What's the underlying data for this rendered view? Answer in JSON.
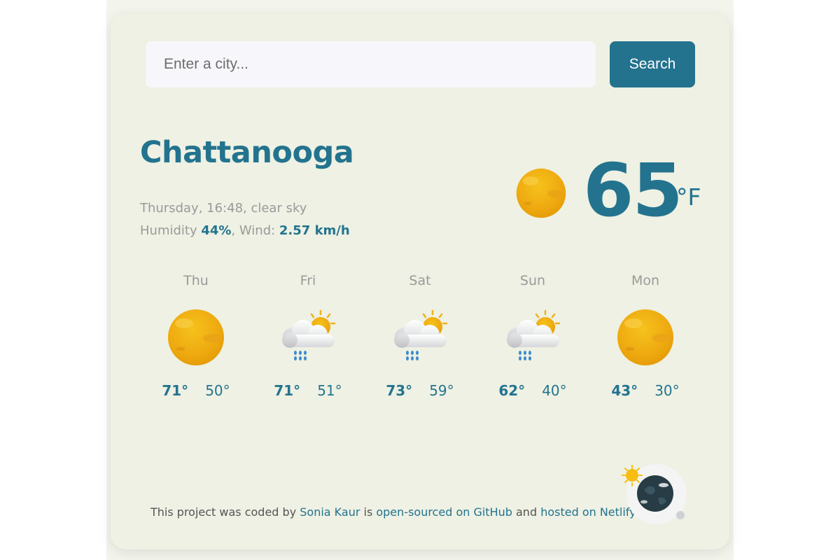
{
  "search": {
    "placeholder": "Enter a city...",
    "value": "",
    "button_label": "Search"
  },
  "current": {
    "city": "Chattanooga",
    "date_desc": "Thursday, 16:48, clear sky",
    "humidity_label": "Humidity ",
    "humidity_value": "44%",
    "wind_label": ", Wind: ",
    "wind_value": "2.57 km/h",
    "temperature": "65",
    "unit": "°F",
    "icon": "sun-icon"
  },
  "forecast": [
    {
      "day": "Thu",
      "high": "71°",
      "low": "50°",
      "icon": "sun-icon"
    },
    {
      "day": "Fri",
      "high": "71°",
      "low": "51°",
      "icon": "rain-cloud-sun-icon"
    },
    {
      "day": "Sat",
      "high": "73°",
      "low": "59°",
      "icon": "rain-cloud-sun-icon"
    },
    {
      "day": "Sun",
      "high": "62°",
      "low": "40°",
      "icon": "rain-cloud-sun-icon"
    },
    {
      "day": "Mon",
      "high": "43°",
      "low": "30°",
      "icon": "sun-icon"
    }
  ],
  "footer": {
    "text_1": "This project was coded by ",
    "author_link": "Sonia Kaur",
    "text_2": " is ",
    "github_link": "open-sourced on GitHub",
    "text_3": " and ",
    "netlify_link": "hosted on Netlify"
  },
  "colors": {
    "accent": "#23738f",
    "card_bg": "#eef1e3",
    "muted_text": "#9a9a9a",
    "sun": "#f2b418"
  }
}
